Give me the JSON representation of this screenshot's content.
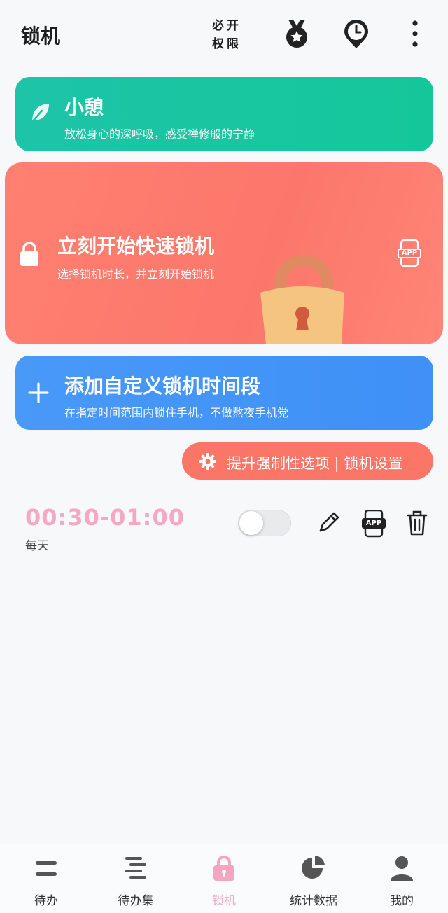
{
  "header": {
    "title": "锁机",
    "permission_line1": "必开",
    "permission_line2": "权限"
  },
  "cards": {
    "rest": {
      "title": "小憩",
      "subtitle": "放松身心的深呼吸，感受禅修般的宁静"
    },
    "quick_lock": {
      "title": "立刻开始快速锁机",
      "subtitle": "选择锁机时长，并立刻开始锁机",
      "app_badge": "APP"
    },
    "custom": {
      "title": "添加自定义锁机时间段",
      "subtitle": "在指定时间范围内锁住手机，不做熬夜手机党"
    }
  },
  "settings_button": {
    "label": "提升强制性选项 | 锁机设置"
  },
  "schedule": {
    "time_range": "00:30-01:00",
    "repeat": "每天",
    "enabled": false,
    "app_badge": "APP"
  },
  "tabs": [
    {
      "label": "待办",
      "icon": "todo-icon"
    },
    {
      "label": "待办集",
      "icon": "todo-set-icon"
    },
    {
      "label": "锁机",
      "icon": "lock-icon",
      "active": true
    },
    {
      "label": "统计数据",
      "icon": "stats-icon"
    },
    {
      "label": "我的",
      "icon": "profile-icon"
    }
  ],
  "colors": {
    "rest_card": "#1ec4a8",
    "quick_card": "#fb776b",
    "custom_card": "#4899f8",
    "accent_pink": "#f6a8c2",
    "settings_pill": "#fb7667"
  }
}
